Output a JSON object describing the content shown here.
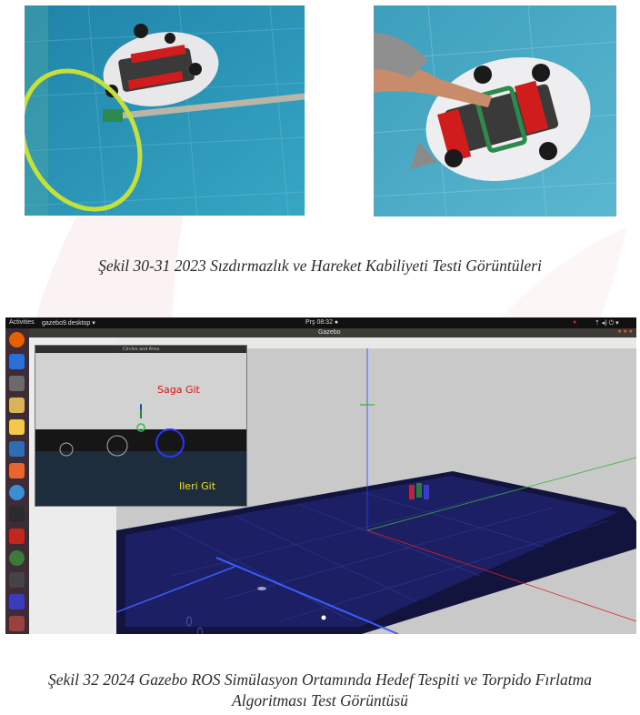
{
  "figure_top": {
    "caption": "Şekil 30-31 2023 Sızdırmazlık ve Hareket Kabiliyeti Testi Görüntüleri",
    "photos": [
      {
        "subject": "robot-with-hoop-photo"
      },
      {
        "subject": "robot-handled-photo"
      }
    ]
  },
  "figure_bottom": {
    "caption_line1": "Şekil 32 2024 Gazebo ROS Simülasyon Ortamında Hedef Tespiti ve Torpido Fırlatma",
    "caption_line2": "Algoritması Test Görüntüsü"
  },
  "desktop": {
    "activities": "Activities",
    "app_menu": "gazebo9.desktop ▾",
    "clock": "Prş 08:32 ●",
    "window_title": "Gazebo"
  },
  "overlay_window": {
    "title": "Circles and Area",
    "label_turn": "Saga Git",
    "label_forward": "Ileri Git"
  },
  "colors": {
    "pool_water": "#2f8fb0",
    "hoop": "#c6e03a",
    "turn_text": "#e01010",
    "forward_text": "#f2e21a",
    "pool_floor": "#1a1d5a",
    "pool_grid": "#3a44a8"
  }
}
